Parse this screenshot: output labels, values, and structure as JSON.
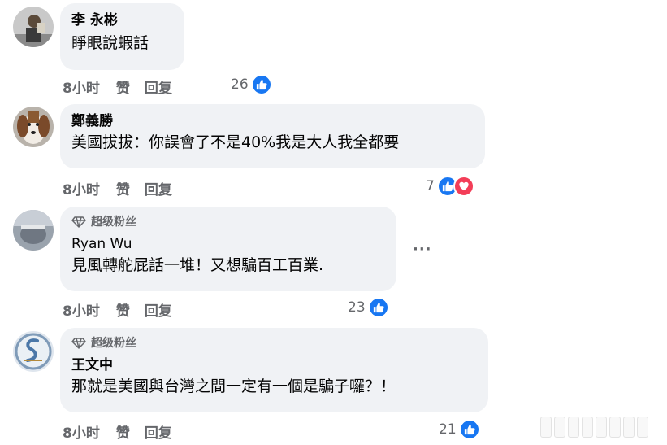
{
  "comments": [
    {
      "author": "李 永彬",
      "badge": null,
      "text": "睜眼說蝦話",
      "time": "8小时",
      "like_label": "赞",
      "reply_label": "回复",
      "reaction_count": "26",
      "reactions": [
        "like-icon"
      ]
    },
    {
      "author": "鄭義勝",
      "badge": null,
      "text": "美國拔拔：你誤會了不是40%我是大人我全都要",
      "time": "8小时",
      "like_label": "赞",
      "reply_label": "回复",
      "reaction_count": "7",
      "reactions": [
        "like-icon",
        "love-icon"
      ]
    },
    {
      "author": "Ryan Wu",
      "badge": "超级粉丝",
      "text": "見風轉舵屁話一堆！又想騙百工百業.",
      "time": "8小时",
      "like_label": "赞",
      "reply_label": "回复",
      "reaction_count": "23",
      "reactions": [
        "like-icon"
      ],
      "more_label": "···"
    },
    {
      "author": "王文中",
      "badge": "超级粉丝",
      "text": "那就是美國與台灣之間一定有一個是騙子囉？！",
      "time": "8小时",
      "like_label": "赞",
      "reply_label": "回复",
      "reaction_count": "21",
      "reactions": [
        "like-icon"
      ]
    }
  ],
  "colors": {
    "bubble": "#f0f2f5",
    "like_blue": "#1877f2",
    "love_red": "#f33e58",
    "meta_gray": "#65676b"
  }
}
